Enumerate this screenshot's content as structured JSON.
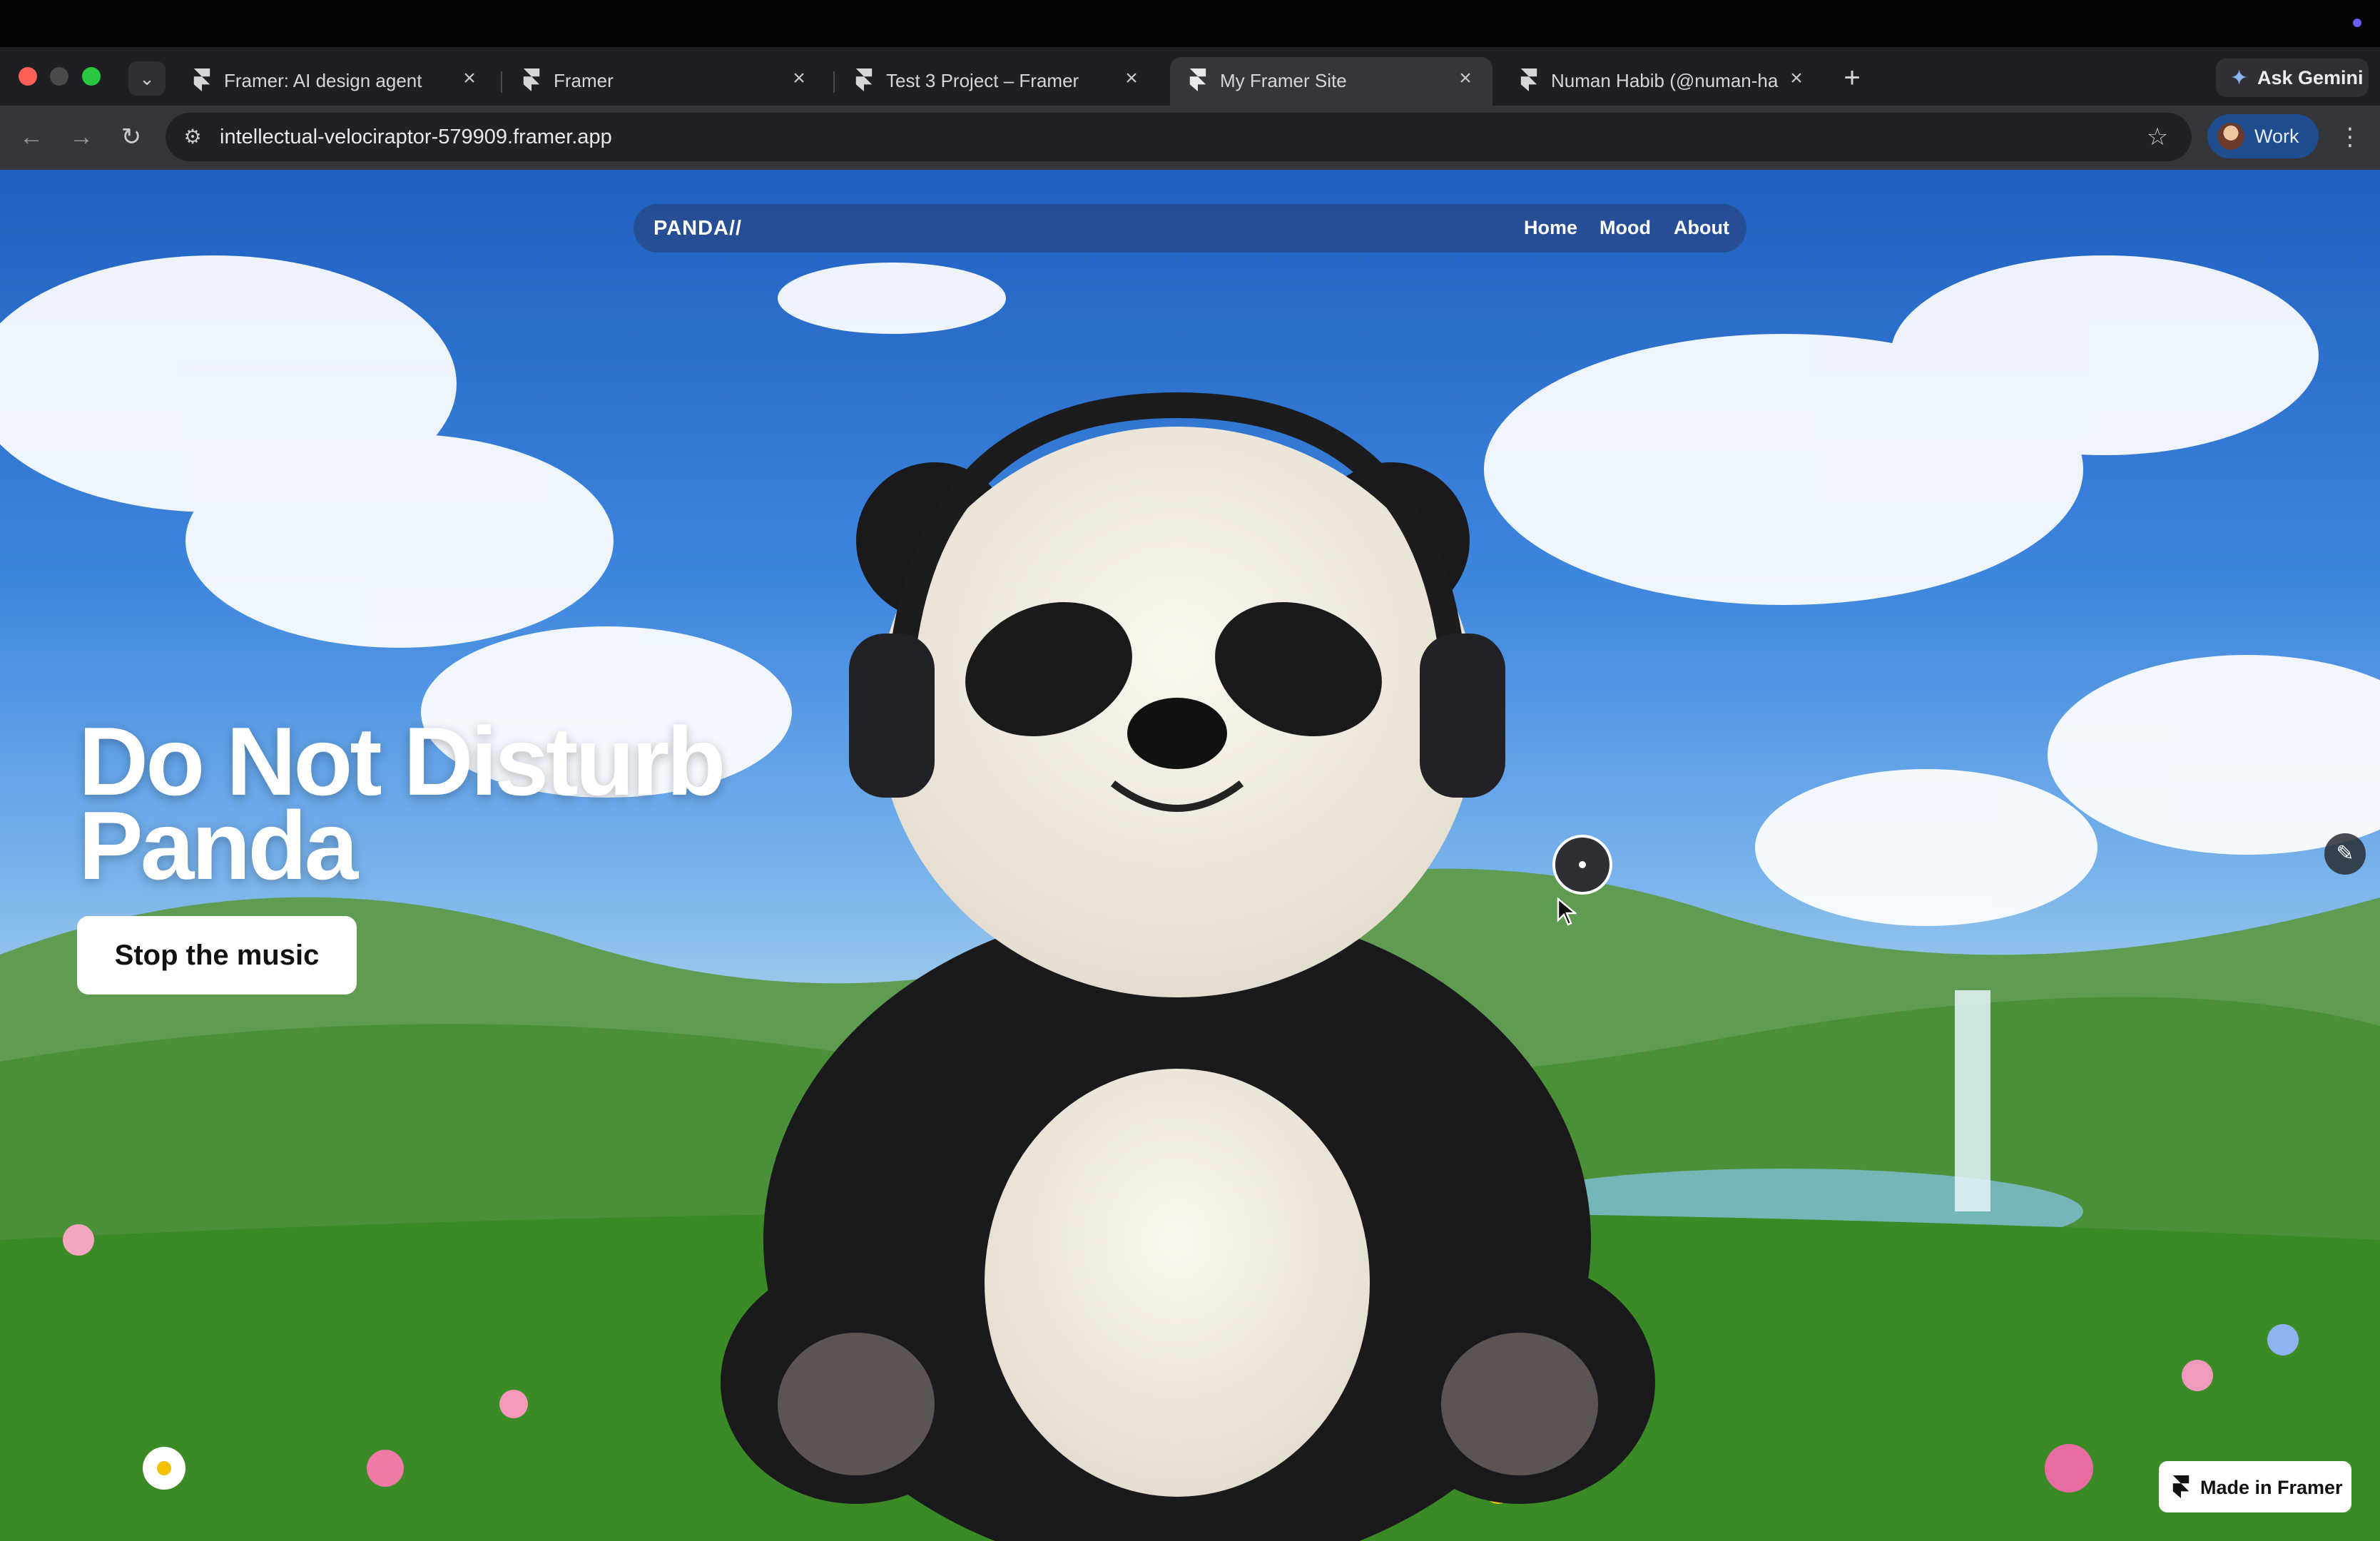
{
  "browser": {
    "tabs": [
      {
        "title": "Framer: AI design agent",
        "active": false
      },
      {
        "title": "Framer",
        "active": false
      },
      {
        "title": "Test 3 Project – Framer",
        "active": false
      },
      {
        "title": "My Framer Site",
        "active": true
      },
      {
        "title": "Numan Habib (@numan-habib",
        "active": false
      }
    ],
    "new_tab_symbol": "+",
    "close_symbol": "×",
    "gemini_label": "Ask Gemini",
    "url": "intellectual-velociraptor-579909.framer.app",
    "profile_label": "Work"
  },
  "site": {
    "logo": "PANDA//",
    "nav": {
      "home": "Home",
      "mood": "Mood",
      "about": "About"
    },
    "hero": {
      "line1": "Do Not Disturb",
      "line2": "Panda"
    },
    "cta_label": "Stop the music",
    "badge_label": "Made in Framer"
  },
  "colors": {
    "accent_profile": "#1f4c8f",
    "sky": "#3d86de",
    "grass": "#3f8a30"
  }
}
